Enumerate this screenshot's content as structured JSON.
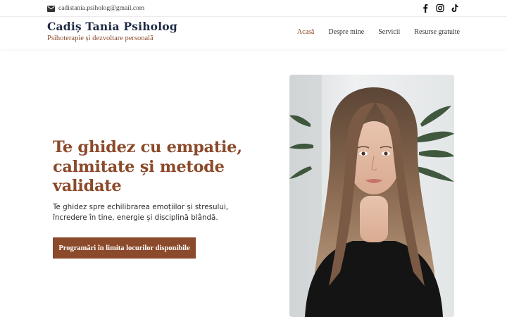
{
  "topbar": {
    "email": "cadistania.psiholog@gmail.com",
    "email_icon": "envelope-icon",
    "socials": [
      {
        "name": "facebook-icon"
      },
      {
        "name": "instagram-icon"
      },
      {
        "name": "tiktok-icon"
      }
    ]
  },
  "brand": {
    "title": "Cadiș Tania Psiholog",
    "subtitle": "Psihoterapie și dezvoltare personală"
  },
  "nav": {
    "items": [
      {
        "label": "Acasă",
        "active": true
      },
      {
        "label": "Despre mine",
        "active": false
      },
      {
        "label": "Servicii",
        "active": false
      },
      {
        "label": "Resurse gratuite",
        "active": false
      }
    ]
  },
  "hero": {
    "title": "Te ghidez cu empatie, calmitate și metode validate",
    "text": "Te ghidez spre echilibrarea emoțiilor și stresului, încredere în tine, energie și disciplină blândă.",
    "cta_label": "Programări în limita locurilor disponibile"
  },
  "colors": {
    "accent": "#8b4a2b",
    "brand_navy": "#1f2a44",
    "cta_text": "#ffffff"
  }
}
